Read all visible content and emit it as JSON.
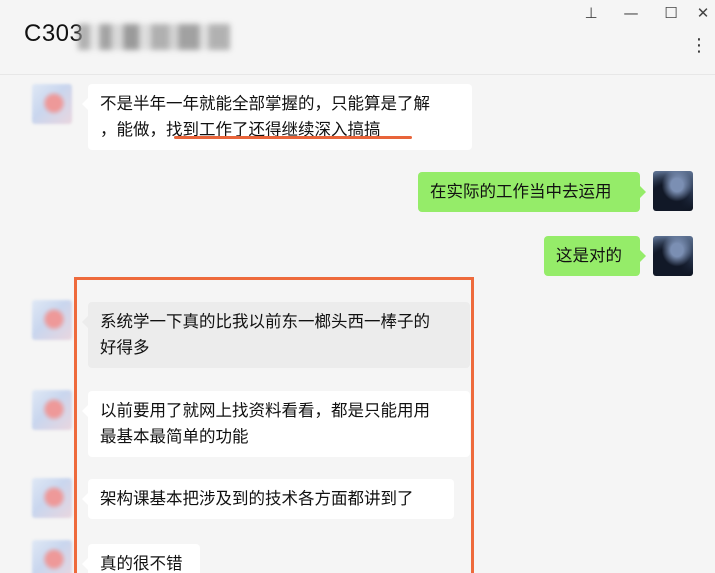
{
  "window": {
    "title": "C303",
    "controls": {
      "pin": "⊥",
      "minimize": "—",
      "maximize": "☐",
      "close": "✕"
    },
    "more": "⋮"
  },
  "messages": [
    {
      "side": "left",
      "lines": [
        "不是半年一年就能全部掌握的，只能算是了解",
        "，能做，找到工作了还得继续深入搞搞"
      ]
    },
    {
      "side": "right",
      "lines": [
        "在实际的工作当中去运用"
      ]
    },
    {
      "side": "right",
      "lines": [
        "这是对的"
      ]
    },
    {
      "side": "left",
      "lines": [
        "系统学一下真的比我以前东一榔头西一棒子的",
        "好得多"
      ]
    },
    {
      "side": "left",
      "lines": [
        "以前要用了就网上找资料看看，都是只能用用",
        "最基本最简单的功能"
      ]
    },
    {
      "side": "left",
      "lines": [
        "架构课基本把涉及到的技术各方面都讲到了"
      ]
    },
    {
      "side": "left",
      "lines": [
        "真的很不错"
      ]
    }
  ],
  "colors": {
    "background": "#f5f5f5",
    "bubble_self": "#95ec69",
    "bubble_other": "#ffffff",
    "annotation": "#ee6a3c"
  },
  "icons": {
    "pin": "pin-icon",
    "minimize": "minimize-icon",
    "maximize": "maximize-icon",
    "close": "close-icon",
    "more": "more-vertical-icon"
  }
}
